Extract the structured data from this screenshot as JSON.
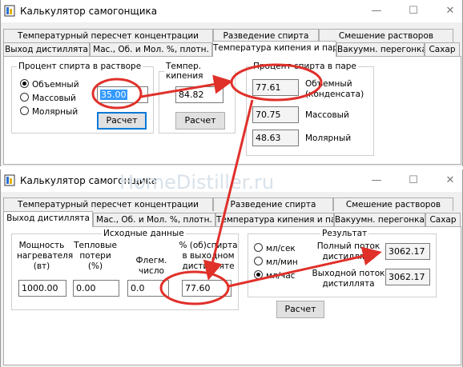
{
  "window_title": "Калькулятор самогонщика",
  "caption_buttons": [
    "—",
    "☐",
    "✕"
  ],
  "watermark": "HomeDistiller.ru",
  "accent_color": "#e0302a",
  "tabs_row1": [
    "Температурный пересчет концентрации",
    "Разведение спирта",
    "Смешение растворов"
  ],
  "window1": {
    "tabs_row2": [
      "Выход дистиллята",
      "Мас., Об. и Мол. %, плотн.",
      "Температура кипения и пар",
      "Вакуумн. перегонка",
      "Сахар"
    ],
    "active_tab": "Температура кипения и пар",
    "alcohol_group": {
      "legend": "Процент спирта в растворе",
      "options": [
        "Объемный",
        "Массовый",
        "Молярный"
      ],
      "selected": "Объемный",
      "value": "35.00",
      "button": "Расчет"
    },
    "boil_group": {
      "legend": "Темпер. кипения",
      "value": "84.82",
      "button": "Расчет"
    },
    "vapor_group": {
      "legend": "Процент спирта в паре",
      "volumetric_value": "77.61",
      "volumetric_label": "Объемный (конденсата)",
      "mass_value": "70.75",
      "mass_label": "Массовый",
      "molar_value": "48.63",
      "molar_label": "Молярный"
    }
  },
  "window2": {
    "tabs_row1": [
      "Температурный пересчет концентрации",
      "Разведение спирта",
      "Смешение растворов"
    ],
    "tabs_row2": [
      "Выход дистиллята",
      "Мас., Об. и Мол. %, плотн.",
      "Температура кипения и пар",
      "Вакуумн. перегонка",
      "Сахар"
    ],
    "active_tab": "Выход дистиллята",
    "input_group": {
      "legend": "Исходные данные",
      "fields": [
        {
          "label": "Мощность нагревателя (вт)",
          "value": "1000.00"
        },
        {
          "label": "Тепловые потери (%)",
          "value": "0.00"
        },
        {
          "label": "Флегм. число",
          "value": "0.0"
        },
        {
          "label": "% (об)спирта в выходном дистилляте",
          "value": "77.60"
        }
      ]
    },
    "result_group": {
      "legend": "Результат",
      "units": [
        "мл/сек",
        "мл/мин",
        "мл/час"
      ],
      "selected_unit": "мл/час",
      "full_flow_label": "Полный поток дистиллята",
      "full_flow_value": "3062.17",
      "out_flow_label": "Выходной поток дистиллята",
      "out_flow_value": "3062.17"
    },
    "button": "Расчет"
  }
}
